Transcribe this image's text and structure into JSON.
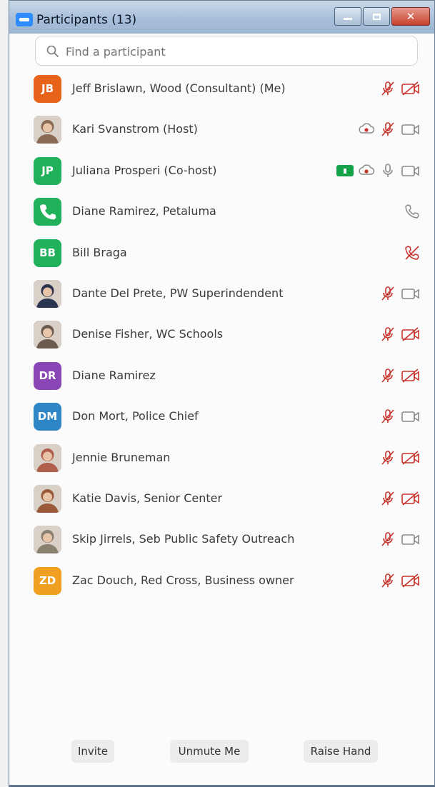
{
  "window": {
    "title": "Participants (13)"
  },
  "search": {
    "placeholder": "Find a participant"
  },
  "colors": {
    "muted_red": "#c8322a",
    "icon_gray": "#8a8a8a",
    "share_green": "#13a14a"
  },
  "participants": [
    {
      "name": "Jeff Brislawn, Wood (Consultant) (Me)",
      "initials": "JB",
      "avatar_color": "#e8631a",
      "avatar_type": "initials",
      "icons": [
        "mic-muted-icon",
        "video-off-icon"
      ]
    },
    {
      "name": "Kari Svanstrom (Host)",
      "initials": "",
      "avatar_color": "#8a6a55",
      "avatar_type": "photo",
      "icons": [
        "record-icon",
        "mic-muted-icon",
        "video-on-icon"
      ]
    },
    {
      "name": "Juliana Prosperi (Co-host)",
      "initials": "JP",
      "avatar_color": "#21b15a",
      "avatar_type": "initials",
      "icons": [
        "share-screen-icon",
        "record-icon",
        "mic-on-icon",
        "video-on-icon"
      ]
    },
    {
      "name": "Diane Ramirez, Petaluma",
      "initials": "",
      "avatar_color": "#21b15a",
      "avatar_type": "phone",
      "icons": [
        "phone-icon"
      ]
    },
    {
      "name": "Bill Braga",
      "initials": "BB",
      "avatar_color": "#21b15a",
      "avatar_type": "initials",
      "icons": [
        "phone-muted-icon"
      ]
    },
    {
      "name": "Dante Del Prete, PW Superindendent",
      "initials": "",
      "avatar_color": "#2c3550",
      "avatar_type": "photo",
      "icons": [
        "mic-muted-icon",
        "video-on-icon"
      ]
    },
    {
      "name": "Denise Fisher, WC Schools",
      "initials": "",
      "avatar_color": "#6b5a4e",
      "avatar_type": "photo",
      "icons": [
        "mic-muted-icon",
        "video-off-icon"
      ]
    },
    {
      "name": "Diane Ramirez",
      "initials": "DR",
      "avatar_color": "#8b46b5",
      "avatar_type": "initials",
      "icons": [
        "mic-muted-icon",
        "video-off-icon"
      ]
    },
    {
      "name": "Don Mort, Police Chief",
      "initials": "DM",
      "avatar_color": "#2f86c6",
      "avatar_type": "initials",
      "icons": [
        "mic-muted-icon",
        "video-on-icon"
      ]
    },
    {
      "name": "Jennie Bruneman",
      "initials": "",
      "avatar_color": "#b0604a",
      "avatar_type": "photo",
      "icons": [
        "mic-muted-icon",
        "video-off-icon"
      ]
    },
    {
      "name": "Katie Davis, Senior Center",
      "initials": "",
      "avatar_color": "#9a5a3a",
      "avatar_type": "photo",
      "icons": [
        "mic-muted-icon",
        "video-off-icon"
      ]
    },
    {
      "name": "Skip Jirrels, Seb Public Safety Outreach",
      "initials": "",
      "avatar_color": "#8a8070",
      "avatar_type": "photo",
      "icons": [
        "mic-muted-icon",
        "video-on-icon"
      ]
    },
    {
      "name": "Zac Douch, Red Cross, Business owner",
      "initials": "ZD",
      "avatar_color": "#f0a020",
      "avatar_type": "initials",
      "icons": [
        "mic-muted-icon",
        "video-off-icon"
      ]
    }
  ],
  "footer": {
    "invite_label": "Invite",
    "unmute_label": "Unmute Me",
    "raise_hand_label": "Raise Hand"
  }
}
